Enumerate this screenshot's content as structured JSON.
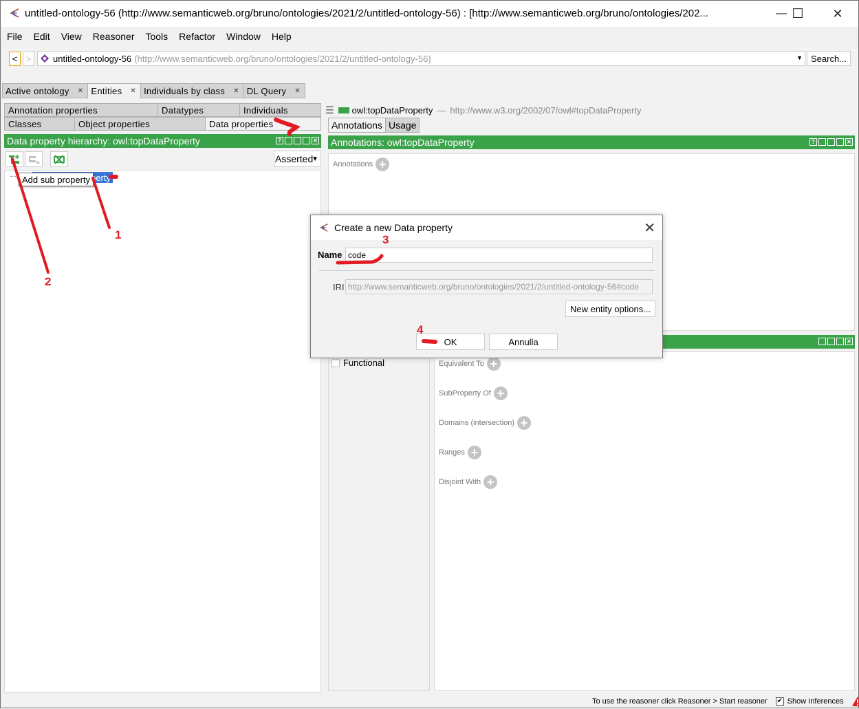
{
  "window": {
    "title": "untitled-ontology-56 (http://www.semanticweb.org/bruno/ontologies/2021/2/untitled-ontology-56)  : [http://www.semanticweb.org/bruno/ontologies/202...",
    "minimize": "—",
    "maximize": "☐",
    "close": "✕"
  },
  "menu": [
    "File",
    "Edit",
    "View",
    "Reasoner",
    "Tools",
    "Refactor",
    "Window",
    "Help"
  ],
  "address": {
    "back": "<",
    "forward": ">",
    "ontology_name": "untitled-ontology-56",
    "ontology_iri": "(http://www.semanticweb.org/bruno/ontologies/2021/2/untitled-ontology-56)",
    "search_label": "Search..."
  },
  "top_tabs": [
    {
      "label": "Active ontology",
      "active": false
    },
    {
      "label": "Entities",
      "active": true
    },
    {
      "label": "Individuals by class",
      "active": false
    },
    {
      "label": "DL Query",
      "active": false
    }
  ],
  "entity_tabs": {
    "row1": [
      "Annotation properties",
      "Datatypes",
      "Individuals"
    ],
    "row2": [
      "Classes",
      "Object properties",
      "Data properties"
    ],
    "active": "Data properties"
  },
  "hierarchy": {
    "title": "Data property hierarchy: owl:topDataProperty",
    "mode": "Asserted",
    "tree_node": "roperty",
    "tooltip": "Add sub property",
    "toolbar": [
      "add-sub-property",
      "add-sibling-property",
      "delete-property"
    ]
  },
  "entity": {
    "name": "owl:topDataProperty",
    "separator": "—",
    "iri": "http://www.w3.org/2002/07/owl#topDataProperty",
    "tabs": [
      "Annotations",
      "Usage"
    ],
    "active_tab": "Annotations",
    "annotations_header": "Annotations: owl:topDataProperty",
    "annotations_label": "Annotations",
    "characteristics": [
      {
        "label": "Functional",
        "checked": false
      }
    ],
    "description_sections": [
      "Equivalent To",
      "SubProperty Of",
      "Domains (intersection)",
      "Ranges",
      "Disjoint With"
    ]
  },
  "dialog": {
    "title": "Create a new Data property",
    "name_label": "Name",
    "name_value": "code",
    "iri_label": "IRI",
    "iri_value": "http://www.semanticweb.org/bruno/ontologies/2021/2/untitled-ontology-56#code",
    "options_label": "New entity options...",
    "ok_label": "OK",
    "cancel_label": "Annulla"
  },
  "status": {
    "message": "To use the reasoner click Reasoner > Start reasoner",
    "show_inferences_label": "Show Inferences",
    "show_inferences_checked": true
  },
  "annotations_overlay": [
    "1",
    "2",
    "3",
    "4"
  ],
  "colors": {
    "accent_green": "#3aa34a",
    "selection_blue": "#3875d7",
    "annotation_red": "#e01b24"
  }
}
